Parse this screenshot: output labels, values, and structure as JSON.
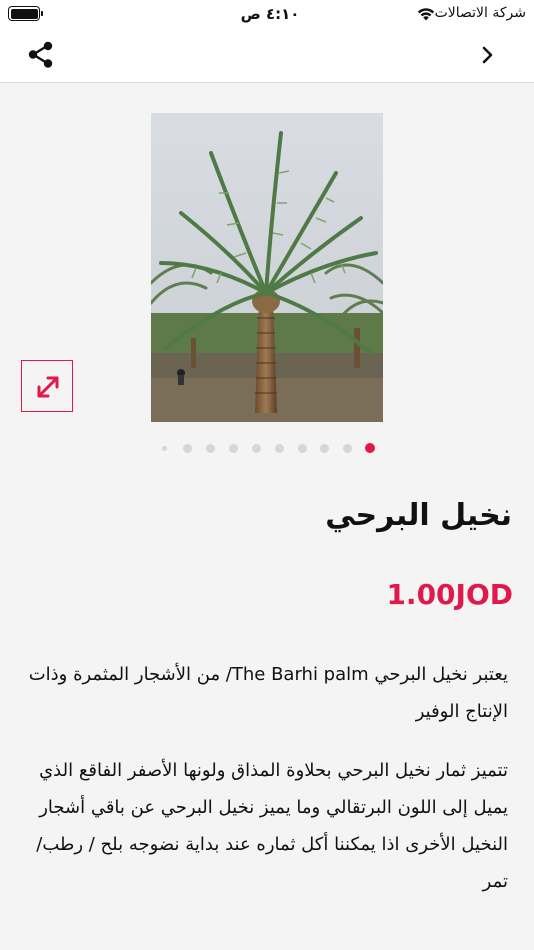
{
  "status_bar": {
    "carrier": "شركة الاتصالات",
    "time": "٤:١٠ ص",
    "icons": [
      "wifi-icon",
      "battery-icon"
    ]
  },
  "nav": {
    "share_icon": "share-icon",
    "back_icon": "chevron-right-icon"
  },
  "product": {
    "image_alt": "Date palm tree in orchard",
    "title": "نخيل البرحي",
    "price": "1.00JOD",
    "description": [
      "يعتبر نخيل البرحي The Barhi palm/ من الأشجار المثمرة وذات الإنتاج الوفير",
      "تتميز ثمار نخيل البرحي بحلاوة المذاق ولونها الأصفر الفاقع الذي يميل إلى اللون البرتقالي وما يميز نخيل البرحي عن باقي أشجار النخيل الأخرى اذا يمكننا أكل ثماره عند بداية نضوجه بلح / رطب/ تمر"
    ]
  },
  "gallery": {
    "total_dots": 10,
    "active_index": 0,
    "expand_icon": "expand-icon"
  },
  "colors": {
    "accent": "#e0194a",
    "background": "#f4f4f4"
  }
}
